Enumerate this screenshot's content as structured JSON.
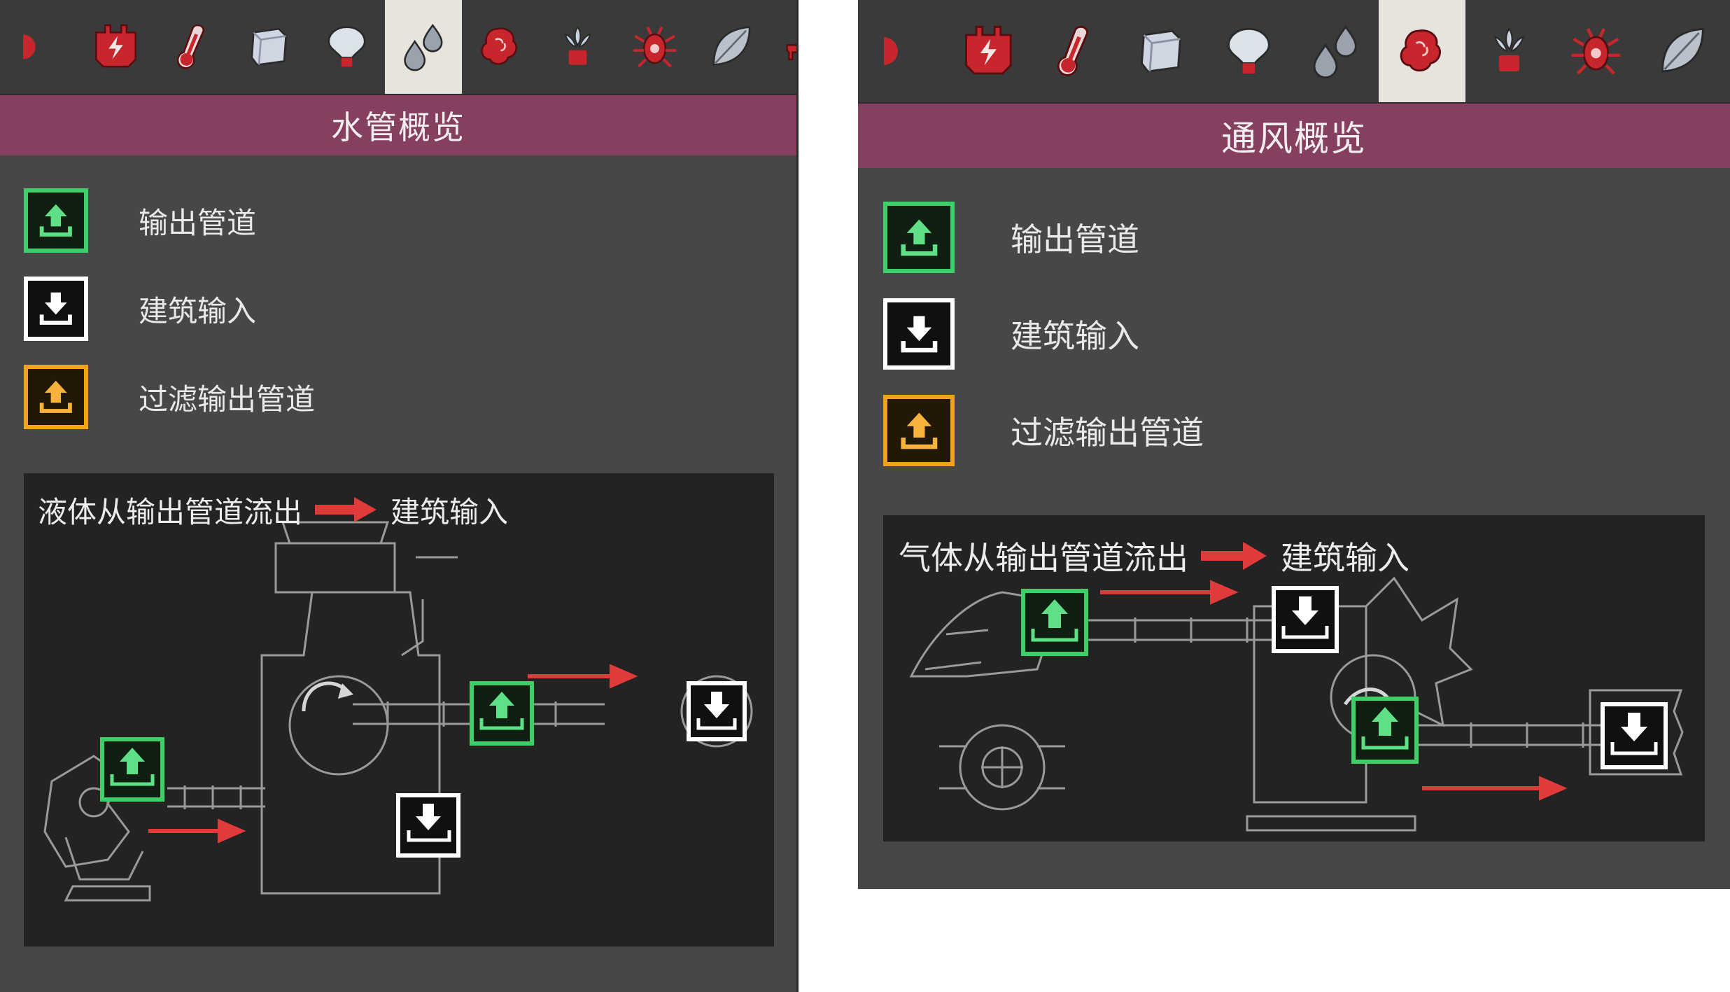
{
  "panels": [
    {
      "id": "plumbing",
      "title": "水管概览",
      "active_tool": "plumbing-overlay-icon",
      "legend": [
        {
          "type": "out",
          "label": "输出管道"
        },
        {
          "type": "in",
          "label": "建筑输入"
        },
        {
          "type": "filter",
          "label": "过滤输出管道"
        }
      ],
      "diagram": {
        "prefix": "液体从输出管道流出",
        "suffix": "建筑输入"
      }
    },
    {
      "id": "ventilation",
      "title": "通风概览",
      "active_tool": "ventilation-overlay-icon",
      "legend": [
        {
          "type": "out",
          "label": "输出管道"
        },
        {
          "type": "in",
          "label": "建筑输入"
        },
        {
          "type": "filter",
          "label": "过滤输出管道"
        }
      ],
      "diagram": {
        "prefix": "气体从输出管道流出",
        "suffix": "建筑输入"
      }
    }
  ],
  "toolbar_icons": [
    "oxygen-overlay-icon",
    "power-overlay-icon",
    "temperature-overlay-icon",
    "materials-overlay-icon",
    "light-overlay-icon",
    "plumbing-overlay-icon",
    "ventilation-overlay-icon",
    "farming-overlay-icon",
    "germ-overlay-icon",
    "decor-overlay-icon",
    "room-overlay-icon"
  ],
  "colors": {
    "title_bar": "#86405f",
    "panel_bg": "#474747",
    "port_out": "#3fcf6a",
    "port_in": "#ffffff",
    "port_filter": "#f2a31b",
    "flow_arrow": "#e03a3a",
    "icon_red": "#c8262d"
  }
}
